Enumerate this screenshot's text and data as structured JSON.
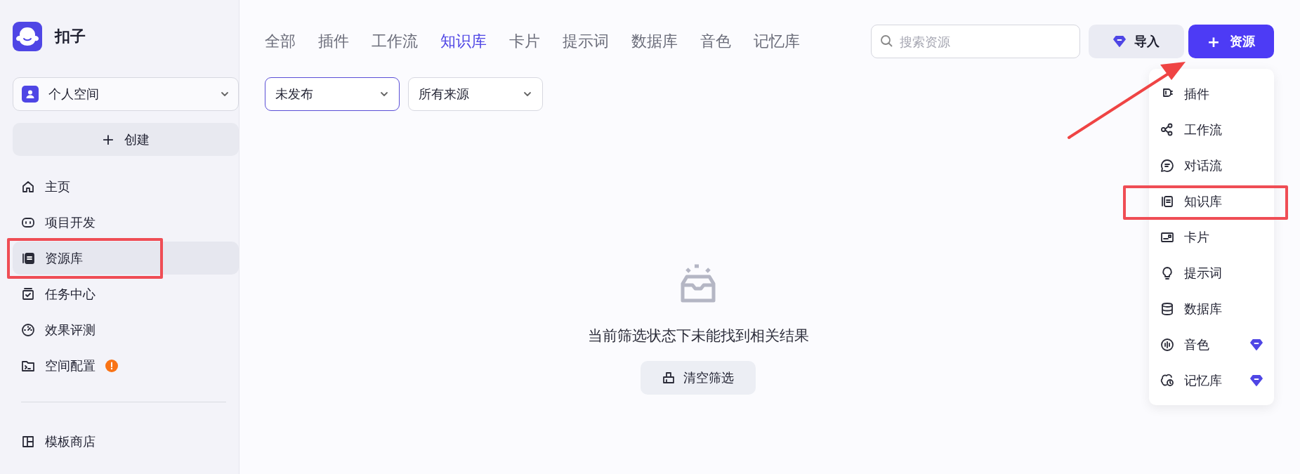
{
  "app": {
    "name": "扣子"
  },
  "space_selector": {
    "label": "个人空间"
  },
  "create_button": {
    "label": "创建",
    "icon": "+"
  },
  "sidebar": {
    "items": [
      {
        "label": "主页",
        "selected": false,
        "alert": false,
        "annotated": false
      },
      {
        "label": "项目开发",
        "selected": false,
        "alert": false,
        "annotated": false
      },
      {
        "label": "资源库",
        "selected": true,
        "alert": false,
        "annotated": true
      },
      {
        "label": "任务中心",
        "selected": false,
        "alert": false,
        "annotated": false
      },
      {
        "label": "效果评测",
        "selected": false,
        "alert": false,
        "annotated": false
      },
      {
        "label": "空间配置",
        "selected": false,
        "alert": true,
        "annotated": false
      }
    ],
    "lower_items": [
      {
        "label": "模板商店",
        "selected": false
      }
    ]
  },
  "tabs": [
    {
      "label": "全部",
      "selected": false
    },
    {
      "label": "插件",
      "selected": false
    },
    {
      "label": "工作流",
      "selected": false
    },
    {
      "label": "知识库",
      "selected": true
    },
    {
      "label": "卡片",
      "selected": false
    },
    {
      "label": "提示词",
      "selected": false
    },
    {
      "label": "数据库",
      "selected": false
    },
    {
      "label": "音色",
      "selected": false
    },
    {
      "label": "记忆库",
      "selected": false
    }
  ],
  "filters": [
    {
      "value": "未发布",
      "focused": true
    },
    {
      "value": "所有来源",
      "focused": false
    }
  ],
  "search": {
    "placeholder": "搜索资源"
  },
  "import_button": {
    "label": "导入"
  },
  "resource_button": {
    "label": "资源",
    "icon": "+",
    "annotated": true
  },
  "resource_menu": {
    "items": [
      {
        "label": "插件",
        "premium": false,
        "annotated": false
      },
      {
        "label": "工作流",
        "premium": false,
        "annotated": false
      },
      {
        "label": "对话流",
        "premium": false,
        "annotated": false
      },
      {
        "label": "知识库",
        "premium": false,
        "annotated": true
      },
      {
        "label": "卡片",
        "premium": false,
        "annotated": false
      },
      {
        "label": "提示词",
        "premium": false,
        "annotated": false
      },
      {
        "label": "数据库",
        "premium": false,
        "annotated": false
      },
      {
        "label": "音色",
        "premium": true,
        "annotated": false
      },
      {
        "label": "记忆库",
        "premium": true,
        "annotated": false
      }
    ]
  },
  "empty_state": {
    "message": "当前筛选状态下未能找到相关结果",
    "button": "清空筛选"
  }
}
